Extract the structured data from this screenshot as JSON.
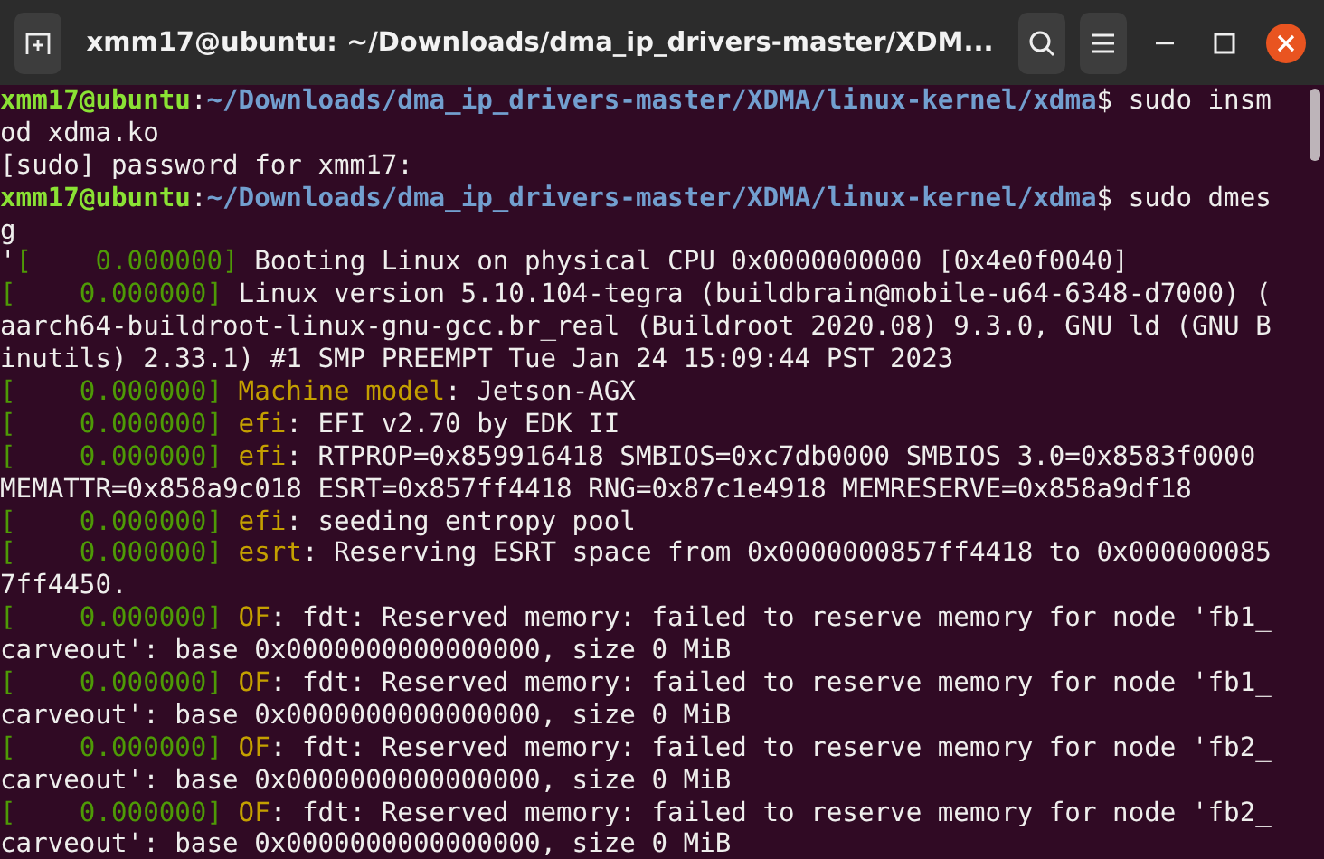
{
  "window": {
    "title": "xmm17@ubuntu: ~/Downloads/dma_ip_drivers-master/XDM..."
  },
  "terminal": {
    "rows": [
      {
        "segments": [
          {
            "kind": "user",
            "text": "xmm17@ubuntu"
          },
          {
            "kind": "plain",
            "text": ":"
          },
          {
            "kind": "path",
            "text": "~/Downloads/dma_ip_drivers-master/XDMA/linux-kernel/xdma"
          },
          {
            "kind": "plain",
            "text": "$ sudo insm"
          }
        ]
      },
      {
        "segments": [
          {
            "kind": "plain",
            "text": "od xdma.ko"
          }
        ]
      },
      {
        "segments": [
          {
            "kind": "plain",
            "text": "[sudo] password for xmm17:"
          }
        ]
      },
      {
        "segments": [
          {
            "kind": "user",
            "text": "xmm17@ubuntu"
          },
          {
            "kind": "plain",
            "text": ":"
          },
          {
            "kind": "path",
            "text": "~/Downloads/dma_ip_drivers-master/XDMA/linux-kernel/xdma"
          },
          {
            "kind": "plain",
            "text": "$ sudo dmes"
          }
        ]
      },
      {
        "segments": [
          {
            "kind": "plain",
            "text": "g"
          }
        ]
      },
      {
        "segments": [
          {
            "kind": "plain",
            "text": "'"
          },
          {
            "kind": "time",
            "text": "[    0.000000]"
          },
          {
            "kind": "plain",
            "text": " Booting Linux on physical CPU 0x0000000000 [0x4e0f0040]"
          }
        ]
      },
      {
        "segments": [
          {
            "kind": "time",
            "text": "[    0.000000]"
          },
          {
            "kind": "plain",
            "text": " Linux version 5.10.104-tegra (buildbrain@mobile-u64-6348-d7000) ("
          }
        ]
      },
      {
        "segments": [
          {
            "kind": "plain",
            "text": "aarch64-buildroot-linux-gnu-gcc.br_real (Buildroot 2020.08) 9.3.0, GNU ld (GNU B"
          }
        ]
      },
      {
        "segments": [
          {
            "kind": "plain",
            "text": "inutils) 2.33.1) #1 SMP PREEMPT Tue Jan 24 15:09:44 PST 2023"
          }
        ]
      },
      {
        "segments": [
          {
            "kind": "time",
            "text": "[    0.000000] "
          },
          {
            "kind": "facility",
            "text": "Machine model"
          },
          {
            "kind": "plain",
            "text": ": Jetson-AGX"
          }
        ]
      },
      {
        "segments": [
          {
            "kind": "time",
            "text": "[    0.000000] "
          },
          {
            "kind": "facility",
            "text": "efi"
          },
          {
            "kind": "plain",
            "text": ": EFI v2.70 by EDK II"
          }
        ]
      },
      {
        "segments": [
          {
            "kind": "time",
            "text": "[    0.000000] "
          },
          {
            "kind": "facility",
            "text": "efi"
          },
          {
            "kind": "plain",
            "text": ": RTPROP=0x859916418 SMBIOS=0xc7db0000 SMBIOS 3.0=0x8583f0000"
          }
        ]
      },
      {
        "segments": [
          {
            "kind": "plain",
            "text": "MEMATTR=0x858a9c018 ESRT=0x857ff4418 RNG=0x87c1e4918 MEMRESERVE=0x858a9df18"
          }
        ]
      },
      {
        "segments": [
          {
            "kind": "time",
            "text": "[    0.000000] "
          },
          {
            "kind": "facility",
            "text": "efi"
          },
          {
            "kind": "plain",
            "text": ": seeding entropy pool"
          }
        ]
      },
      {
        "segments": [
          {
            "kind": "time",
            "text": "[    0.000000] "
          },
          {
            "kind": "facility",
            "text": "esrt"
          },
          {
            "kind": "plain",
            "text": ": Reserving ESRT space from 0x0000000857ff4418 to 0x000000085"
          }
        ]
      },
      {
        "segments": [
          {
            "kind": "plain",
            "text": "7ff4450."
          }
        ]
      },
      {
        "segments": [
          {
            "kind": "time",
            "text": "[    0.000000] "
          },
          {
            "kind": "facility",
            "text": "OF"
          },
          {
            "kind": "plain",
            "text": ": fdt: Reserved memory: failed to reserve memory for node 'fb1_"
          }
        ]
      },
      {
        "segments": [
          {
            "kind": "plain",
            "text": "carveout': base 0x0000000000000000, size 0 MiB"
          }
        ]
      },
      {
        "segments": [
          {
            "kind": "time",
            "text": "[    0.000000] "
          },
          {
            "kind": "facility",
            "text": "OF"
          },
          {
            "kind": "plain",
            "text": ": fdt: Reserved memory: failed to reserve memory for node 'fb1_"
          }
        ]
      },
      {
        "segments": [
          {
            "kind": "plain",
            "text": "carveout': base 0x0000000000000000, size 0 MiB"
          }
        ]
      },
      {
        "segments": [
          {
            "kind": "time",
            "text": "[    0.000000] "
          },
          {
            "kind": "facility",
            "text": "OF"
          },
          {
            "kind": "plain",
            "text": ": fdt: Reserved memory: failed to reserve memory for node 'fb2_"
          }
        ]
      },
      {
        "segments": [
          {
            "kind": "plain",
            "text": "carveout': base 0x0000000000000000, size 0 MiB"
          }
        ]
      },
      {
        "segments": [
          {
            "kind": "time",
            "text": "[    0.000000] "
          },
          {
            "kind": "facility",
            "text": "OF"
          },
          {
            "kind": "plain",
            "text": ": fdt: Reserved memory: failed to reserve memory for node 'fb2_"
          }
        ]
      },
      {
        "segments": [
          {
            "kind": "plain",
            "text": "carveout': base 0x0000000000000000, size 0 MiB"
          }
        ]
      }
    ]
  }
}
